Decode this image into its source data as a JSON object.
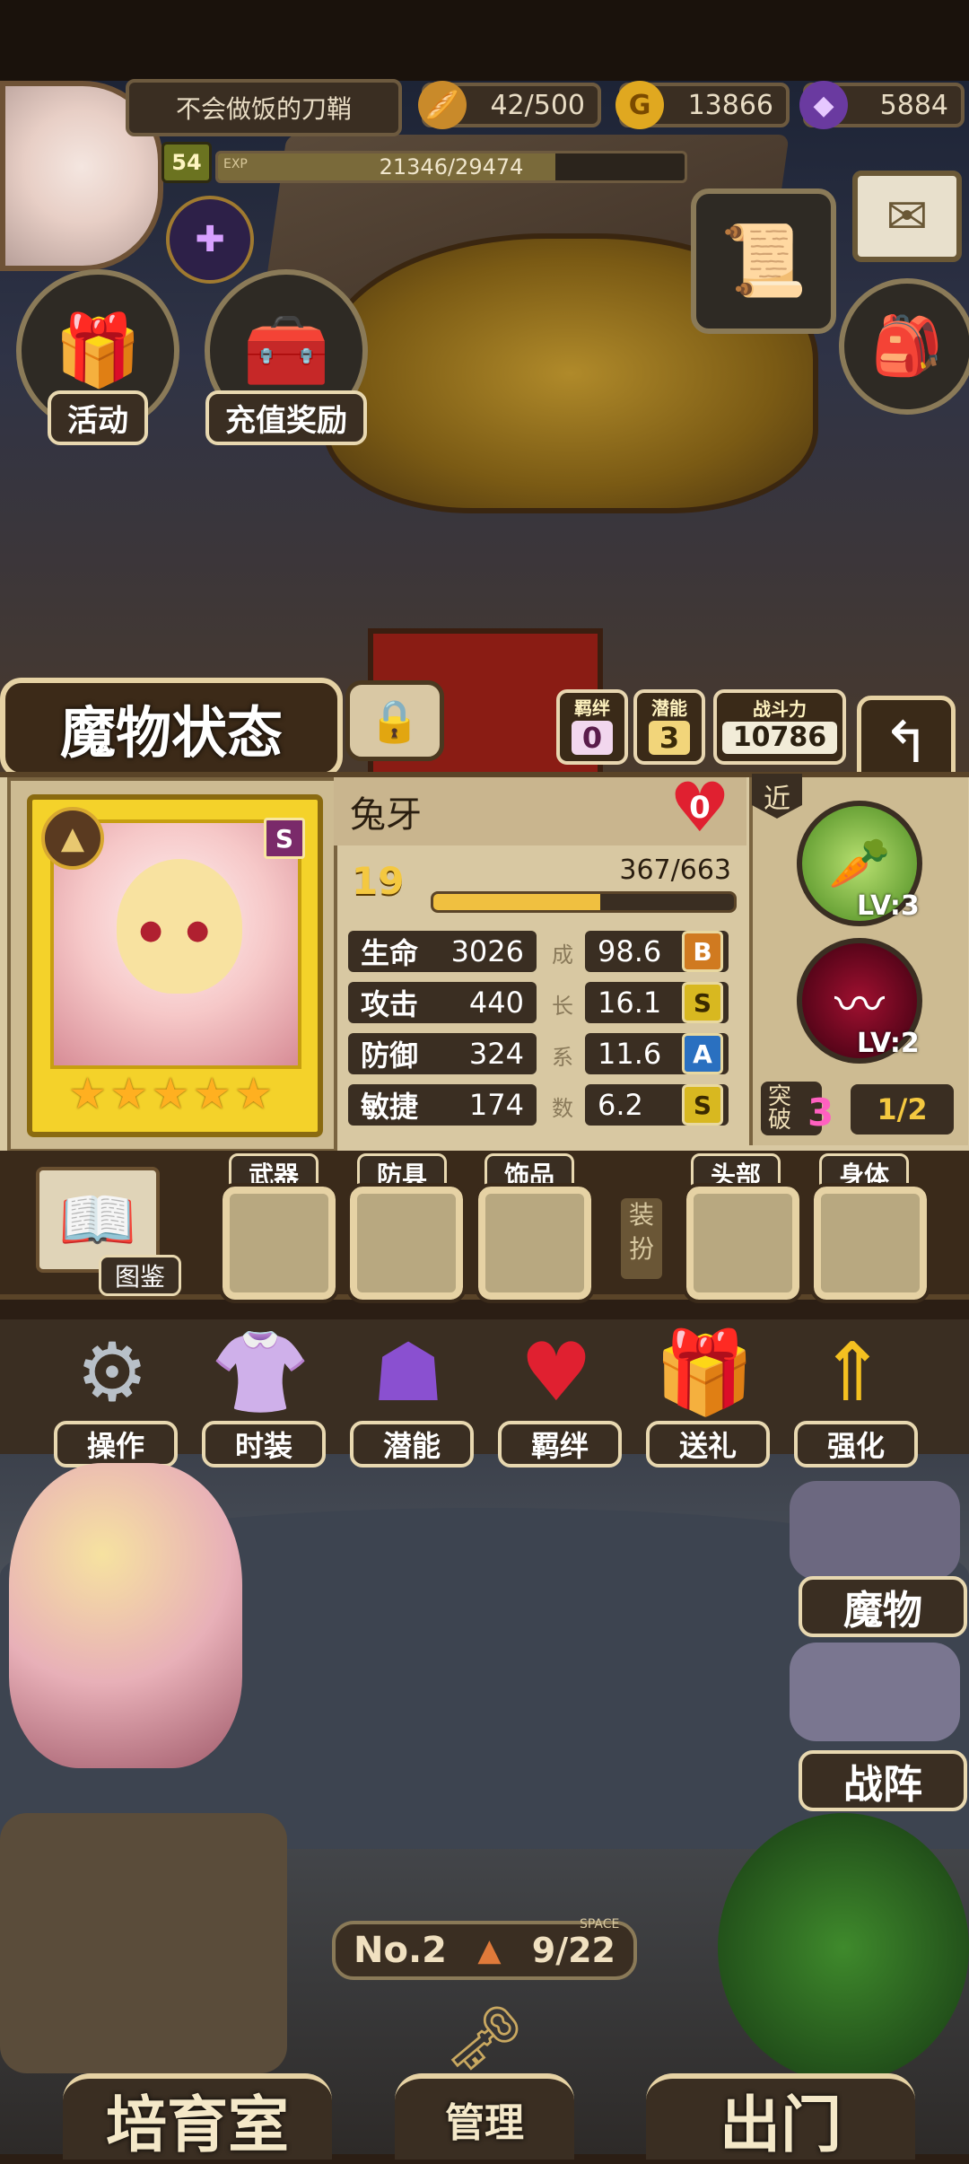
{
  "player": {
    "name": "不会做饭的刀鞘",
    "level": "54",
    "exp_tag": "EXP",
    "exp_text": "21346/29474",
    "exp_fraction": 0.724
  },
  "resources": {
    "stamina": "42/500",
    "gold": "13866",
    "gems": "5884"
  },
  "top_buttons": {
    "event_label": "活动",
    "recharge_label": "充值奖励"
  },
  "monster_status": {
    "title": "魔物状态",
    "bond_label": "羁绊",
    "bond_value": "0",
    "potential_label": "潜能",
    "potential_value": "3",
    "power_label": "战斗力",
    "power_value": "10786"
  },
  "monster": {
    "name": "兔牙",
    "affection": "0",
    "level": "19",
    "exp_text": "367/663",
    "exp_fraction": 0.554,
    "rank": "S",
    "star_count": 5,
    "stats": [
      {
        "label": "生命",
        "value": "3026",
        "growth": "98.6",
        "grade": "B"
      },
      {
        "label": "攻击",
        "value": "440",
        "growth": "16.1",
        "grade": "S"
      },
      {
        "label": "防御",
        "value": "324",
        "growth": "11.6",
        "grade": "A"
      },
      {
        "label": "敏捷",
        "value": "174",
        "growth": "6.2",
        "grade": "S"
      }
    ],
    "growth_vertical": [
      "成",
      "长",
      "系",
      "数"
    ],
    "range": "近",
    "skills": [
      {
        "level": "LV:3"
      },
      {
        "level": "LV:2"
      }
    ],
    "breakthrough_label": "突破",
    "breakthrough_value": "3",
    "breakthrough_progress": "1/2"
  },
  "equipment": {
    "codex_label": "图鉴",
    "slots": [
      "武器",
      "防具",
      "饰品",
      "头部",
      "身体"
    ],
    "dress_label": "装扮"
  },
  "actions": [
    "操作",
    "时装",
    "潜能",
    "羁绊",
    "送礼",
    "强化"
  ],
  "side": {
    "monster_label": "魔物",
    "formation_label": "战阵"
  },
  "storage": {
    "prefix": "No.",
    "number": "2",
    "space_tag": "SPACE",
    "capacity": "9/22"
  },
  "bottom": {
    "nursery": "培育室",
    "manage": "管理",
    "exit": "出门"
  },
  "colors": {
    "panel": "#d8c8a2",
    "dark": "#3a2e22",
    "gold": "#f4c840",
    "grade_B": "#d07a20",
    "grade_S": "#d8b820",
    "grade_A": "#2a70c0"
  }
}
